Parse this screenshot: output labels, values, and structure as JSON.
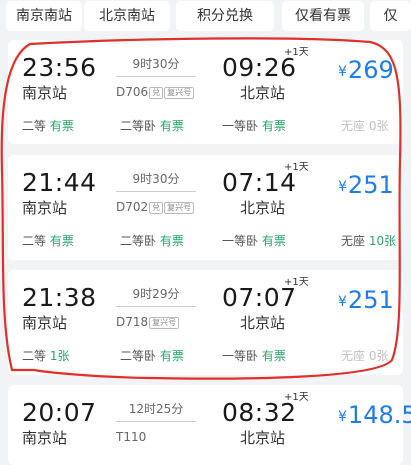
{
  "filters": [
    "南京南站",
    "北京南站",
    "积分兑换",
    "仅看有票",
    "仅"
  ],
  "trains": [
    {
      "depart_time": "23:56",
      "depart_station": "南京站",
      "duration": "9时30分",
      "train_no": "D706",
      "badges": [
        "兑",
        "复兴号"
      ],
      "arrive_time": "09:26",
      "arrive_plus": "+1天",
      "arrive_station": "北京站",
      "price": "269",
      "seats": [
        {
          "class": "二等",
          "status": "有票"
        },
        {
          "class": "二等卧",
          "status": "有票"
        },
        {
          "class": "一等卧",
          "status": "有票"
        },
        {
          "class": "无座",
          "status": "0张",
          "dim": true
        }
      ]
    },
    {
      "depart_time": "21:44",
      "depart_station": "南京站",
      "duration": "9时30分",
      "train_no": "D702",
      "badges": [
        "兑",
        "复兴号"
      ],
      "arrive_time": "07:14",
      "arrive_plus": "+1天",
      "arrive_station": "北京站",
      "price": "251",
      "seats": [
        {
          "class": "二等",
          "status": "有票"
        },
        {
          "class": "二等卧",
          "status": "有票"
        },
        {
          "class": "一等卧",
          "status": "有票"
        },
        {
          "class": "无座",
          "status": "10张"
        }
      ]
    },
    {
      "depart_time": "21:38",
      "depart_station": "南京站",
      "duration": "9时29分",
      "train_no": "D718",
      "badges": [
        "复兴号"
      ],
      "arrive_time": "07:07",
      "arrive_plus": "+1天",
      "arrive_station": "北京站",
      "price": "251",
      "seats": [
        {
          "class": "二等",
          "status": "1张"
        },
        {
          "class": "二等卧",
          "status": "有票"
        },
        {
          "class": "一等卧",
          "status": "有票"
        },
        {
          "class": "无座",
          "status": "0张",
          "dim": true
        }
      ]
    },
    {
      "depart_time": "20:07",
      "depart_station": "南京站",
      "duration": "12时25分",
      "train_no": "T110",
      "badges": [],
      "arrive_time": "08:32",
      "arrive_plus": "+1天",
      "arrive_station": "北京站",
      "price": "148.5",
      "seats": []
    }
  ],
  "currency_symbol": "¥",
  "colors": {
    "price": "#1e7de9",
    "available": "#2ba56a",
    "annotation": "#e0302b"
  }
}
